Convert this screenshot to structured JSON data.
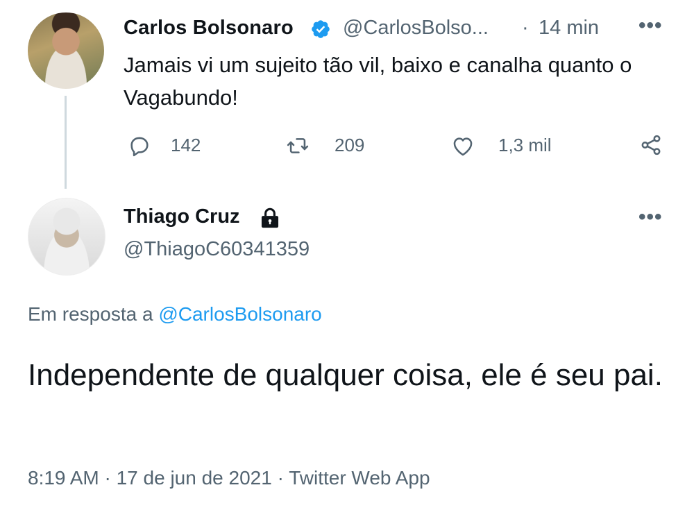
{
  "parent_tweet": {
    "author_name": "Carlos Bolsonaro",
    "verified_icon": "verified-badge-icon",
    "handle": "@CarlosBolso...",
    "separator": "·",
    "time": "14 min",
    "more": "•••",
    "text": "Jamais vi um sujeito tão vil, baixo e canalha quanto o Vagabundo!",
    "actions": {
      "replies": "142",
      "retweets": "209",
      "likes": "1,3 mil"
    }
  },
  "reply_tweet": {
    "author_name": "Thiago Cruz",
    "lock_icon": "lock-icon",
    "handle": "@ThiagoC60341359",
    "more": "•••",
    "replying_prefix": "Em resposta a",
    "replying_to": "@CarlosBolsonaro",
    "text": "Independente de qualquer coisa, ele é seu pai.",
    "timestamp": "8:19 AM · 17 de jun de 2021 · Twitter Web App"
  },
  "colors": {
    "text": "#0f1419",
    "secondary": "#536471",
    "accent": "#1d9bf0"
  }
}
